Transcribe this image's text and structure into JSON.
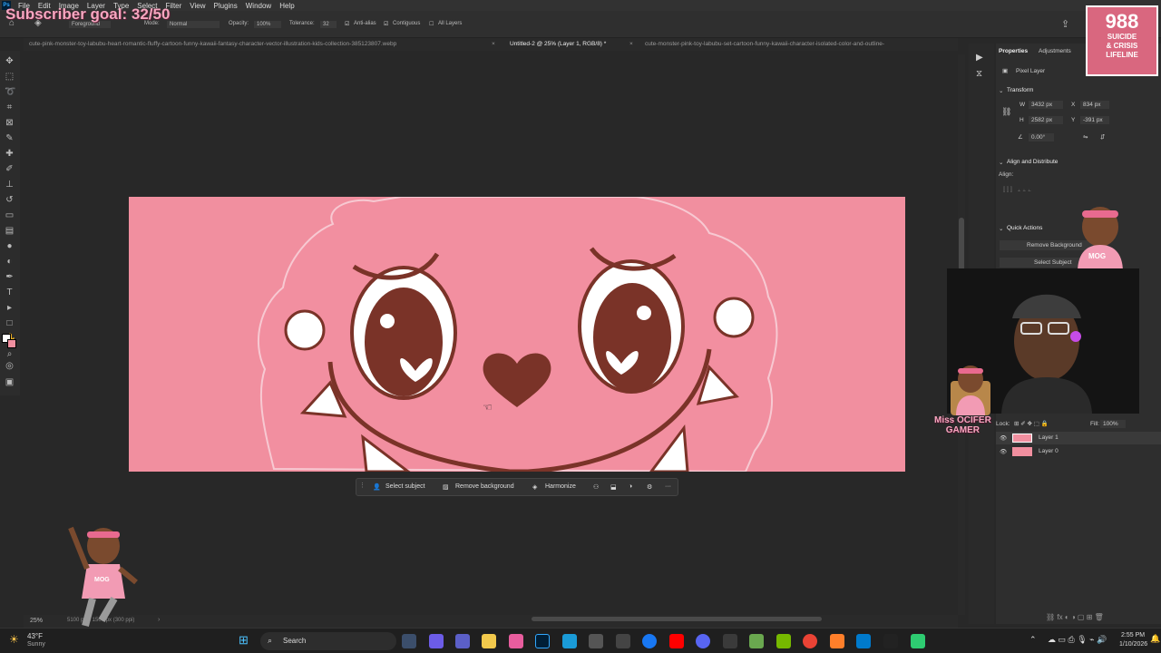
{
  "overlay": {
    "subscriber_goal": "Subscriber goal: 32/50",
    "lifeline_number": "988",
    "lifeline_line1": "SUICIDE",
    "lifeline_line2": "& CRISIS",
    "lifeline_line3": "LIFELINE",
    "streamer_name_1": "Miss OCIFER",
    "streamer_name_2": "GAMER",
    "sticker_badge": "MOG"
  },
  "menubar": {
    "logo": "Ps",
    "items": [
      "File",
      "Edit",
      "Image",
      "Layer",
      "Type",
      "Select",
      "Filter",
      "View",
      "Plugins",
      "Window",
      "Help"
    ]
  },
  "options": {
    "fill_source": "Foreground",
    "mode_label": "Mode:",
    "mode_value": "Normal",
    "opacity_label": "Opacity:",
    "opacity_value": "100%",
    "tolerance_label": "Tolerance:",
    "tolerance_value": "32",
    "antialias_label": "Anti-alias",
    "contiguous_label": "Contiguous",
    "all_layers_label": "All Layers"
  },
  "tabs": [
    {
      "label": "cute-pink-monster-toy-labubu-heart-romantic-fluffy-cartoon-funny-kawaii-fantasy-character-vector-illustration-kids-collection-385123807.webp",
      "active": false
    },
    {
      "label": "Untitled-2 @ 25% (Layer 1, RGB/8) *",
      "active": true
    },
    {
      "label": "cute-monster-pink-toy-labubu-set-cartoon-funny-kawaii-character-isolated-color-and-outline-",
      "active": false
    }
  ],
  "contextual_bar": {
    "select_subject": "Select subject",
    "remove_background": "Remove background",
    "harmonize": "Harmonize",
    "more": "···"
  },
  "properties": {
    "tab_properties": "Properties",
    "tab_adjustments": "Adjustments",
    "layer_kind": "Pixel Layer",
    "transform_title": "Transform",
    "w_label": "W",
    "w_value": "3432 px",
    "h_label": "H",
    "h_value": "2582 px",
    "x_label": "X",
    "x_value": "834 px",
    "y_label": "Y",
    "y_value": "-391 px",
    "angle_value": "0.00°",
    "align_title": "Align and Distribute",
    "align_label": "Align:",
    "quick_actions_title": "Quick Actions",
    "remove_background_btn": "Remove Background",
    "select_subject_btn": "Select Subject"
  },
  "layers": {
    "lock_label": "Lock:",
    "fill_label": "Fill:",
    "fill_value": "100%",
    "items": [
      {
        "name": "Layer 1",
        "selected": true
      },
      {
        "name": "Layer 0",
        "selected": false
      }
    ]
  },
  "status": {
    "zoom": "25%",
    "doc_size": "5100 px x 1500 px (300 ppi)"
  },
  "taskbar": {
    "weather_temp": "43°F",
    "weather_desc": "Sunny",
    "search_label": "Search",
    "time": "2:55 PM",
    "date": "1/10/2026"
  },
  "colors": {
    "canvas_pink": "#f18f9f",
    "accent_pink": "#f7a6c0",
    "outline_brown": "#7a3328",
    "ps_blue": "#31a8ff"
  }
}
